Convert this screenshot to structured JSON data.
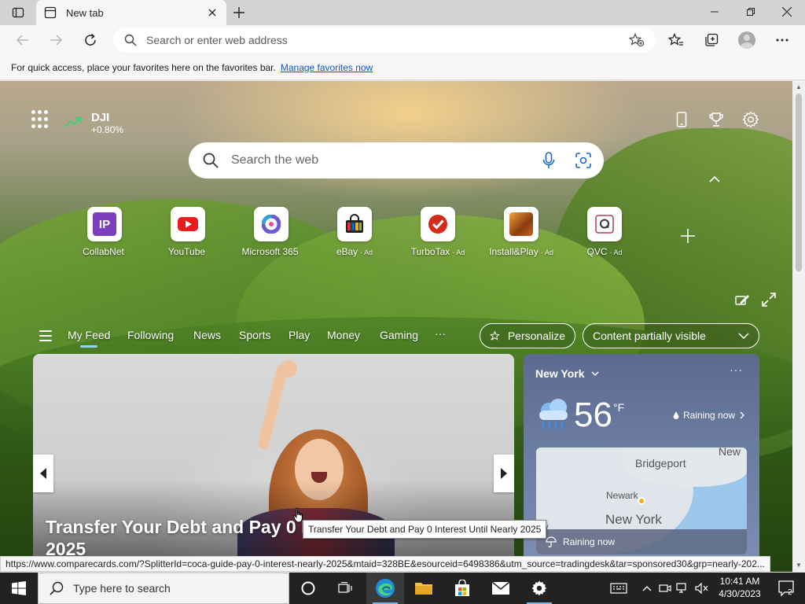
{
  "browser": {
    "tab": {
      "title": "New tab"
    },
    "address": {
      "placeholder": "Search or enter web address"
    },
    "favorites_bar": {
      "message": "For quick access, place your favorites here on the favorites bar.",
      "link": "Manage favorites now"
    }
  },
  "newtab": {
    "stock": {
      "symbol": "DJI",
      "change": "+0.80%"
    },
    "search": {
      "placeholder": "Search the web"
    },
    "quick_links": [
      {
        "label": "CollabNet",
        "ad": "",
        "icon": "collabnet-icon"
      },
      {
        "label": "YouTube",
        "ad": "",
        "icon": "youtube-icon"
      },
      {
        "label": "Microsoft 365",
        "ad": "",
        "icon": "microsoft365-icon"
      },
      {
        "label": "eBay",
        "ad": "· Ad",
        "icon": "ebay-icon"
      },
      {
        "label": "TurboTax",
        "ad": "· Ad",
        "icon": "turbotax-icon"
      },
      {
        "label": "Install&Play",
        "ad": "· Ad",
        "icon": "installplay-icon"
      },
      {
        "label": "QVC",
        "ad": "· Ad",
        "icon": "qvc-icon"
      }
    ],
    "feed_nav": {
      "items": [
        "My Feed",
        "Following",
        "News",
        "Sports",
        "Play",
        "Money",
        "Gaming"
      ],
      "more": "···",
      "personalize": "Personalize",
      "content_visibility": "Content partially visible"
    },
    "hero": {
      "headline": "Transfer Your Debt and Pay 0 Interest Until Nearly 2025",
      "headline_visible": "Transfer Your Debt and Pay 0 I 2025"
    },
    "weather": {
      "city": "New York",
      "temp": "56",
      "unit": "°F",
      "condition": "Raining now",
      "map_labels": {
        "bridgeport": "Bridgeport",
        "new": "New",
        "newark": "Newark",
        "newyork": "New York",
        "prefix": "ew"
      },
      "map_footer": "Raining now",
      "more": "···"
    }
  },
  "tooltip": "Transfer Your Debt and Pay 0 Interest Until Nearly 2025",
  "status_url": "https://www.comparecards.com/?SplitterId=coca-guide-pay-0-interest-nearly-2025&mtaid=328BE&esourceid=6498386&utm_source=tradingdesk&tar=sponsored30&grp=nearly-202...",
  "taskbar": {
    "search_placeholder": "Type here to search",
    "time": "10:41 AM",
    "date": "4/30/2023",
    "notifications": "2"
  }
}
